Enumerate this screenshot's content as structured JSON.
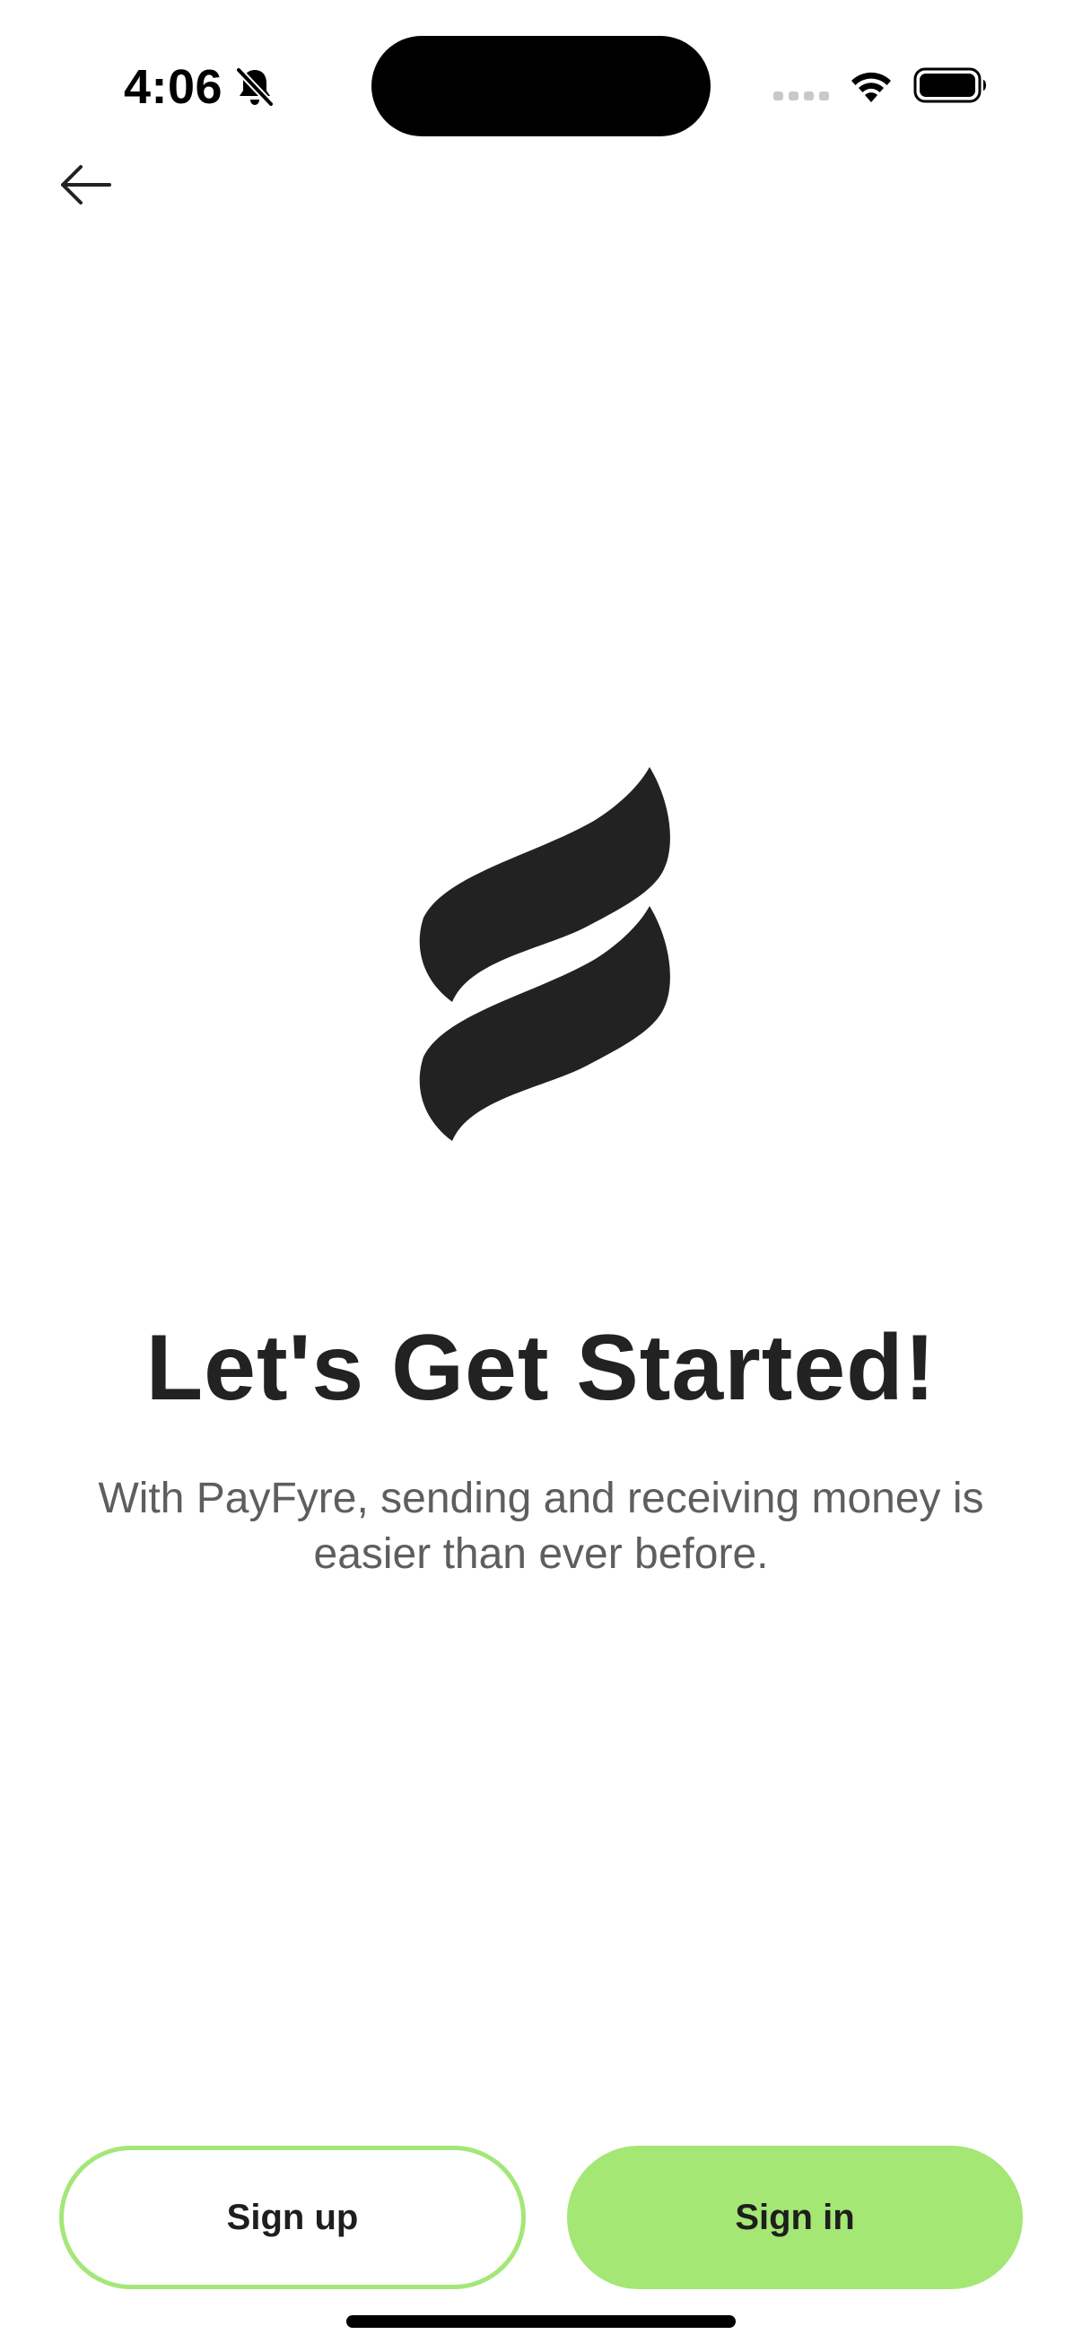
{
  "status_bar": {
    "time": "4:06",
    "icons": [
      "bell-slash-icon",
      "cellular-signal-icon",
      "wifi-icon",
      "battery-icon"
    ]
  },
  "nav": {
    "back_icon": "arrow-left-icon"
  },
  "logo": {
    "icon": "payfyre-logo-icon",
    "color": "#222222"
  },
  "hero": {
    "title": "Let's Get Started!",
    "subtitle": "With PayFyre, sending and receiving money is easier than ever before."
  },
  "actions": {
    "sign_up_label": "Sign up",
    "sign_in_label": "Sign in"
  },
  "colors": {
    "accent": "#a4e774",
    "text_primary": "#222222",
    "text_secondary": "#5e5e5e"
  }
}
